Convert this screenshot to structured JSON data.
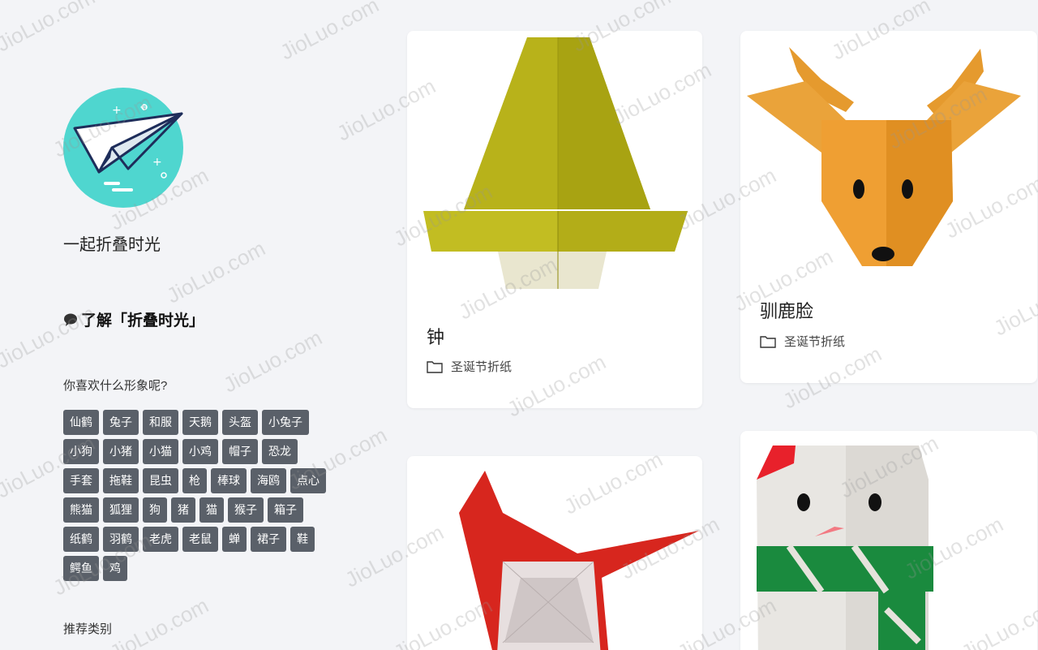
{
  "site": {
    "name": "一起折叠时光"
  },
  "about": {
    "label": "了解「折叠时光」"
  },
  "tags_section": {
    "title": "你喜欢什么形象呢?",
    "tags": [
      "仙鹤",
      "兔子",
      "和服",
      "天鹅",
      "头盔",
      "小兔子",
      "小狗",
      "小猪",
      "小猫",
      "小鸡",
      "帽子",
      "恐龙",
      "手套",
      "拖鞋",
      "昆虫",
      "枪",
      "棒球",
      "海鸥",
      "点心",
      "熊猫",
      "狐狸",
      "狗",
      "猪",
      "猫",
      "猴子",
      "箱子",
      "纸鹤",
      "羽鹤",
      "老虎",
      "老鼠",
      "蝉",
      "裙子",
      "鞋",
      "鳄鱼",
      "鸡"
    ]
  },
  "recommend_section": {
    "title": "推荐类别"
  },
  "cards": [
    {
      "title": "钟",
      "category": "圣诞节折纸"
    },
    {
      "title": "驯鹿脸",
      "category": "圣诞节折纸"
    },
    {
      "title": "",
      "category": ""
    },
    {
      "title": "",
      "category": ""
    }
  ],
  "watermark": "JioLuo.com",
  "colors": {
    "background": "#f3f4f7",
    "tag_bg": "#5a6069",
    "logo_circle": "#4fd6cf"
  }
}
